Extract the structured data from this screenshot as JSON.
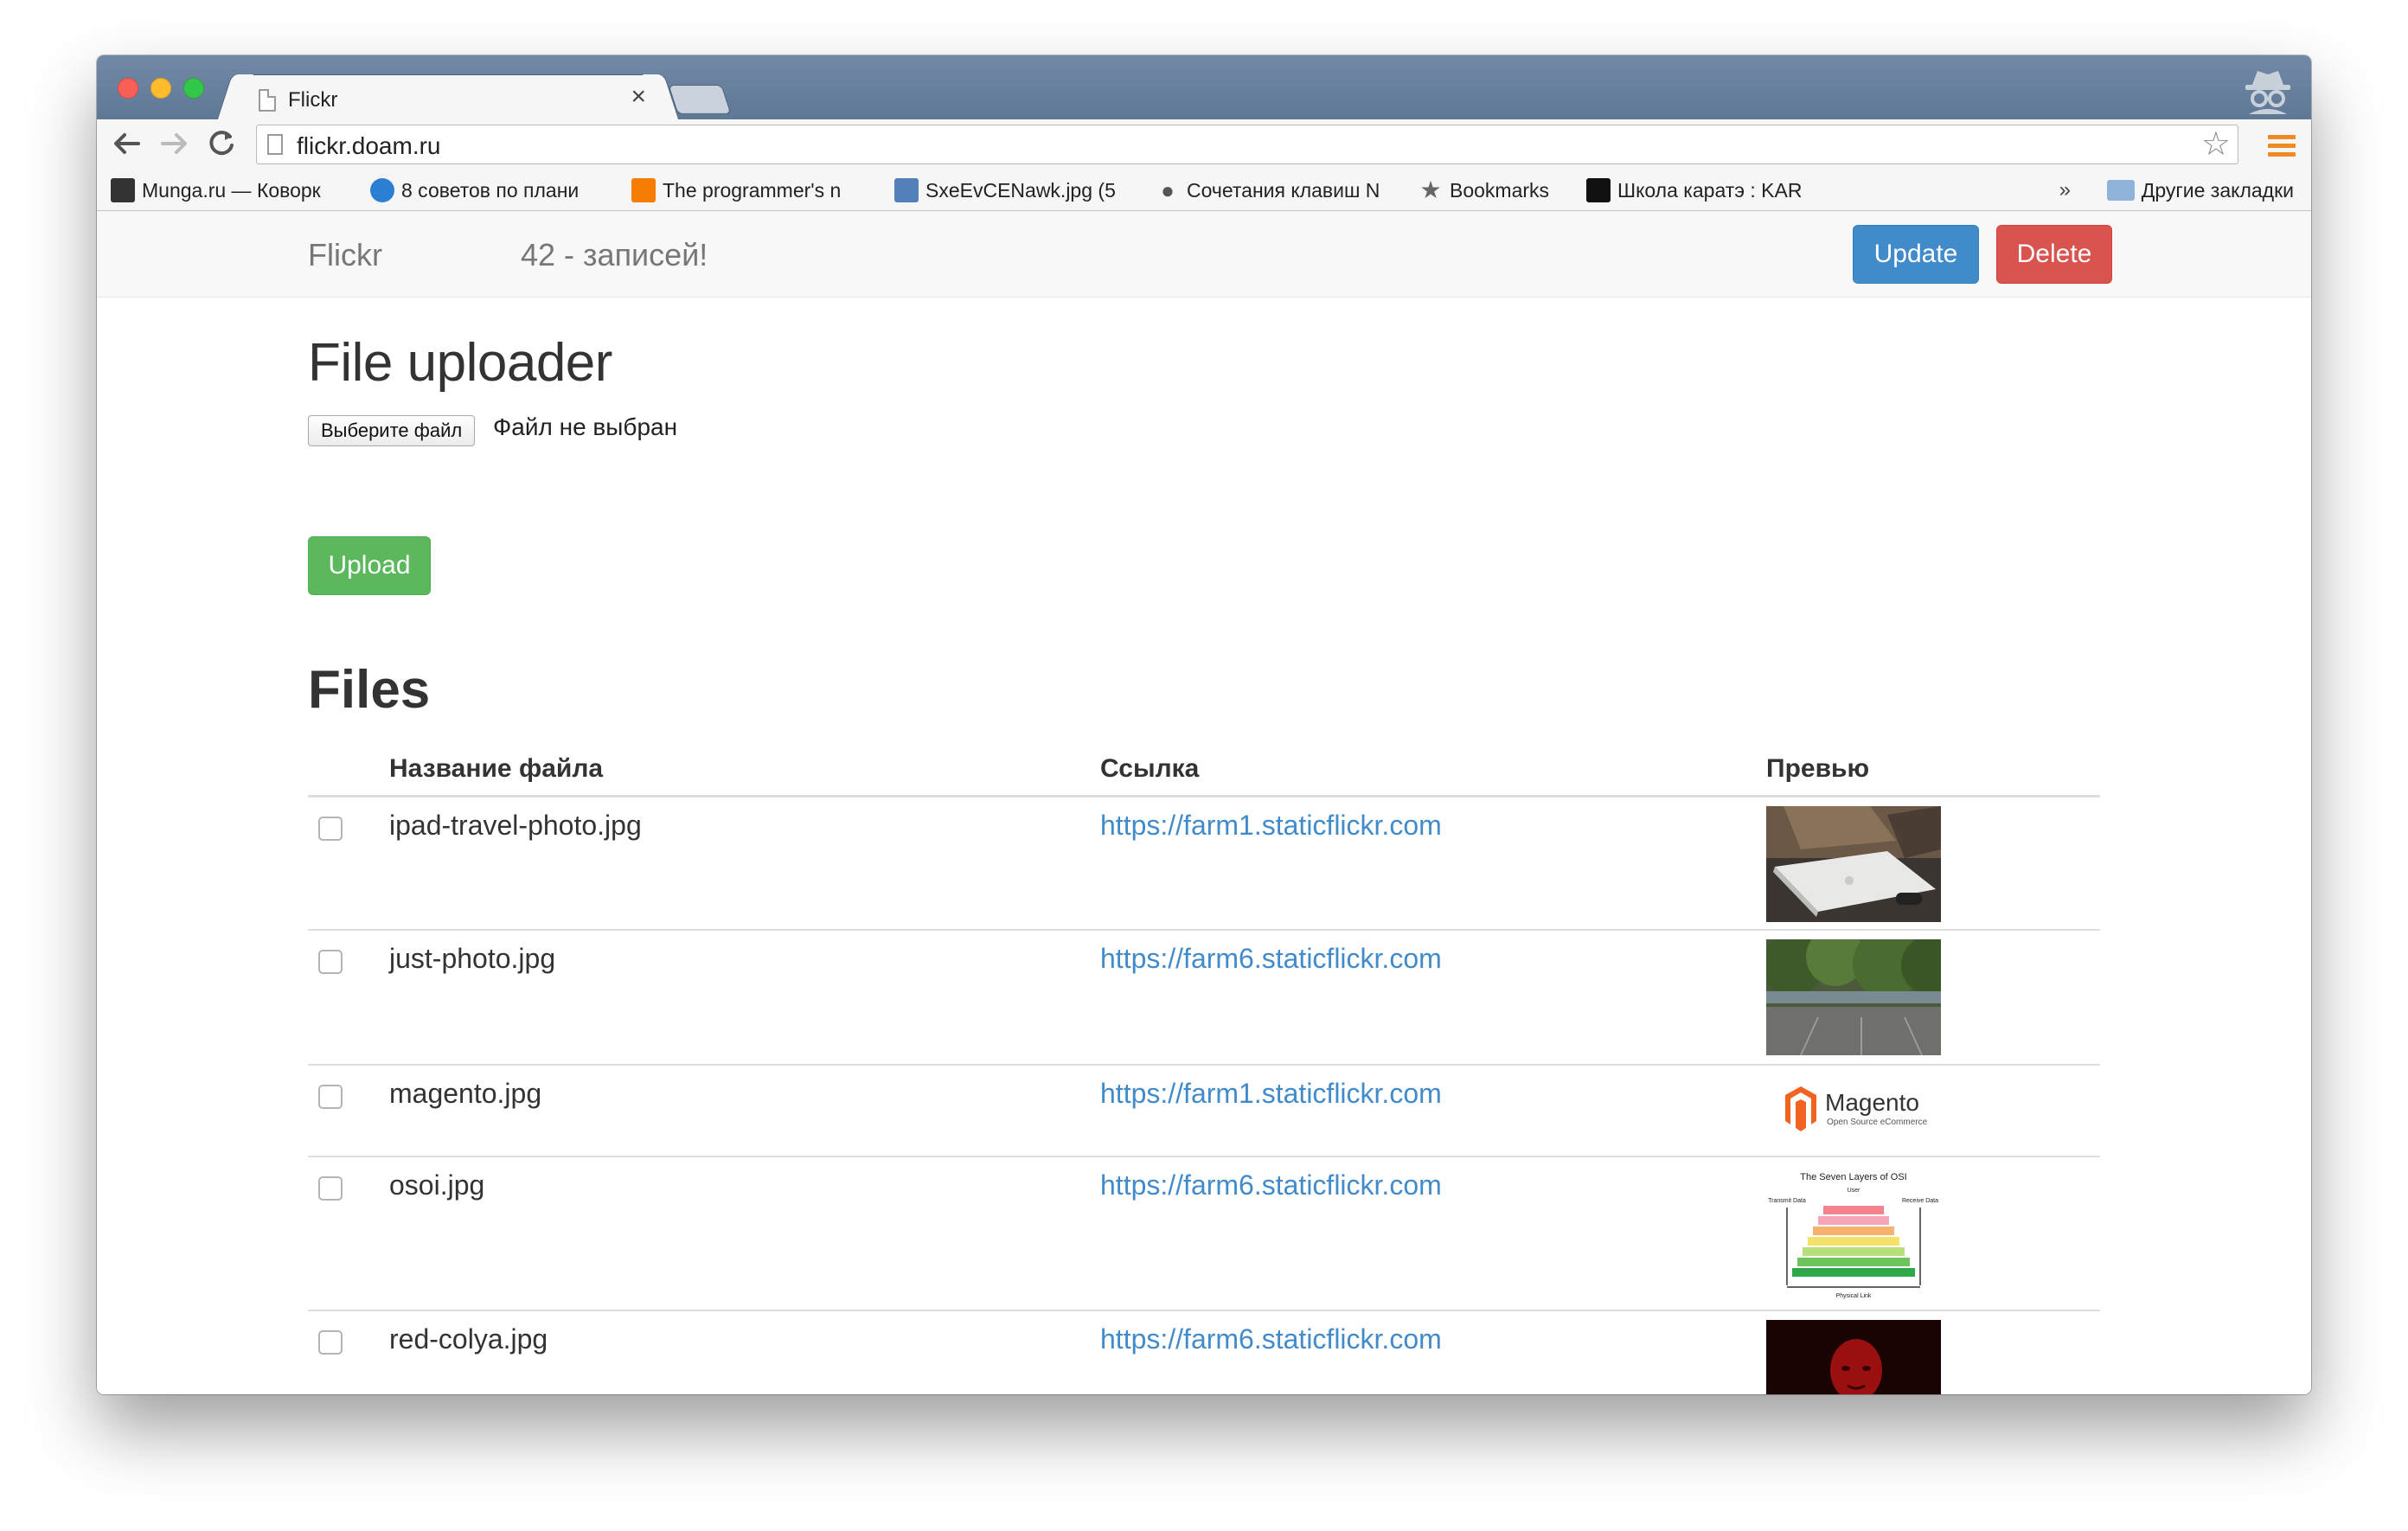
{
  "browser": {
    "tab_title": "Flickr",
    "tab_close": "×",
    "url": "flickr.doam.ru",
    "bookmarks": [
      {
        "label": "Munga.ru — Коворк",
        "icon": "munga-icon",
        "color": "#333333"
      },
      {
        "label": "8 советов по плани",
        "icon": "bird-icon",
        "color": "#2a7fd4"
      },
      {
        "label": "The programmer's n",
        "icon": "blogger-icon",
        "color": "#f57d00"
      },
      {
        "label": "SxeEvCENawk.jpg (5",
        "icon": "vk-icon",
        "color": "#5181b8"
      },
      {
        "label": "Сочетания клавиш N",
        "icon": "apple-icon",
        "color": "#555555"
      },
      {
        "label": "Bookmarks",
        "icon": "star-icon",
        "color": "#666666"
      },
      {
        "label": "Школа каратэ : KAR",
        "icon": "karate-icon",
        "color": "#111111"
      }
    ],
    "bookmarks_overflow": "»",
    "other_bookmarks": "Другие закладки"
  },
  "navbar": {
    "brand": "Flickr",
    "count_text": "42 - записей!",
    "update_label": "Update",
    "delete_label": "Delete"
  },
  "uploader": {
    "heading": "File uploader",
    "choose_label": "Выберите файл",
    "status_text": "Файл не выбран",
    "upload_label": "Upload"
  },
  "files": {
    "heading": "Files",
    "columns": [
      "Название файла",
      "Ссылка",
      "Превью"
    ],
    "rows": [
      {
        "name": "ipad-travel-photo.jpg",
        "link": "https://farm1.staticflickr.com",
        "preview": "ipad-photo"
      },
      {
        "name": "just-photo.jpg",
        "link": "https://farm6.staticflickr.com",
        "preview": "park-photo"
      },
      {
        "name": "magento.jpg",
        "link": "https://farm1.staticflickr.com",
        "preview": "magento-logo"
      },
      {
        "name": "osoi.jpg",
        "link": "https://farm6.staticflickr.com",
        "preview": "osi-diagram"
      },
      {
        "name": "red-colya.jpg",
        "link": "https://farm6.staticflickr.com",
        "preview": "red-portrait"
      }
    ],
    "magento_logo": {
      "title": "Magento",
      "sub": "Open Source eCommerce"
    },
    "osi_diagram": {
      "title": "The Seven Layers of OSI",
      "top": "User",
      "bottom": "Physical Link",
      "left": "Transmit Data",
      "right": "Receive Data"
    }
  },
  "colors": {
    "primary": "#428bca",
    "danger": "#d9534f",
    "success": "#5cb85c",
    "link": "#428bca"
  }
}
